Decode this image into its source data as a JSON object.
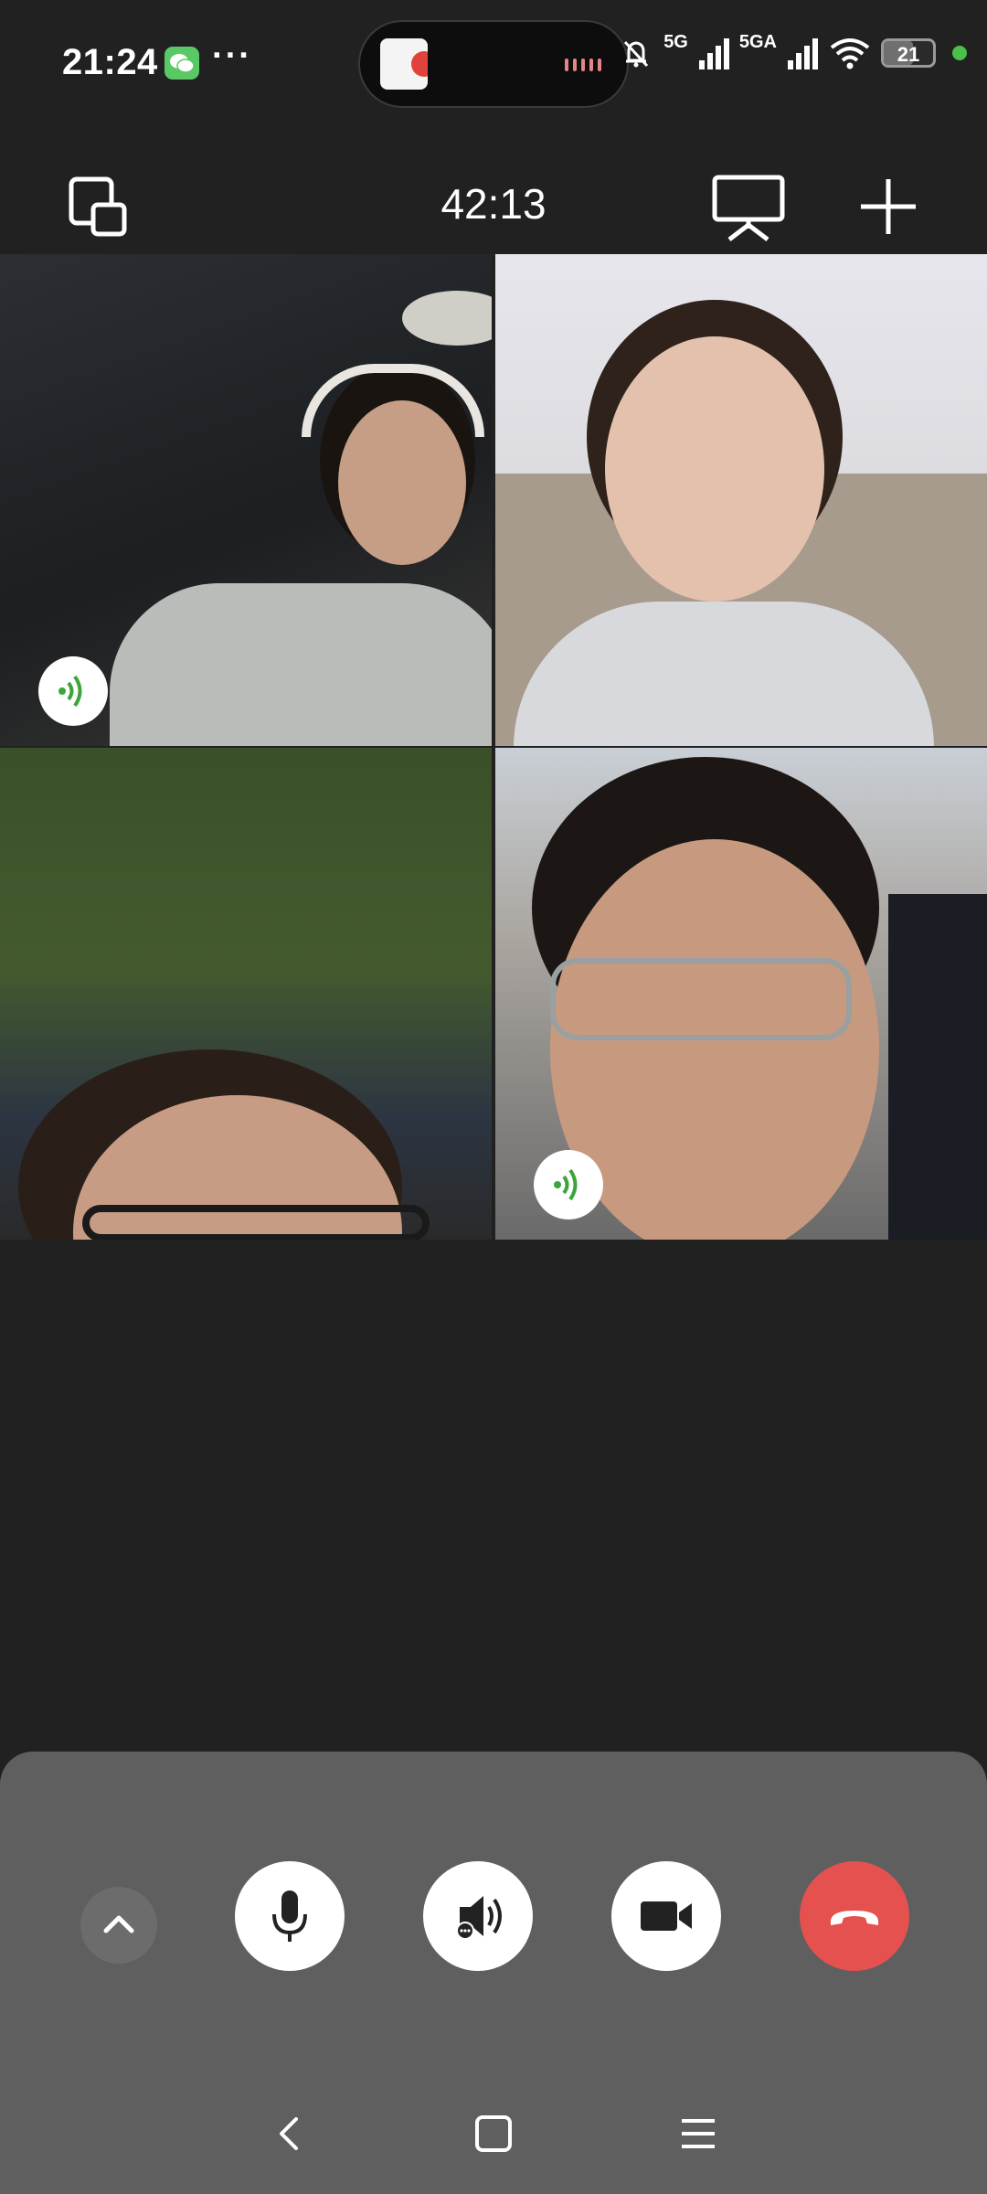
{
  "status_bar": {
    "time": "21:24",
    "overflow": "···",
    "network_1": "5G",
    "network_2": "5GA",
    "battery_level": "21"
  },
  "call": {
    "timer": "42:13"
  },
  "participants": [
    {
      "speaking": true
    },
    {
      "speaking": false
    },
    {
      "speaking": false
    },
    {
      "speaking": true
    }
  ],
  "colors": {
    "background": "#212121",
    "control_sheet": "#5f5f5f",
    "hangup": "#e5514f",
    "speaking_indicator": "#3aa63a"
  },
  "icons": {
    "minimize": "window-minimize-icon",
    "share_screen": "screen-share-icon",
    "add": "plus-icon",
    "expand": "chevron-up-icon",
    "mic": "microphone-icon",
    "speaker": "speaker-icon",
    "camera": "video-camera-icon",
    "hangup": "hang-up-icon"
  }
}
